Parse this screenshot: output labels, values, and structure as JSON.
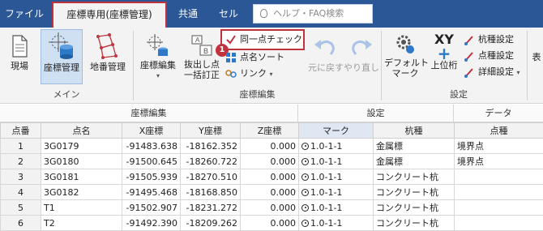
{
  "tabs": [
    {
      "label": "ファイル"
    },
    {
      "label": "座標専用(座標管理)"
    },
    {
      "label": "共通"
    },
    {
      "label": "セル"
    }
  ],
  "search": {
    "placeholder": "ヘルプ・FAQ検索"
  },
  "ribbon": {
    "main": {
      "genba": "現場",
      "zahyo_kanri": "座標管理",
      "chiban_kanri": "地番管理",
      "group_label": "メイン"
    },
    "edit": {
      "zahyo_henshu": "座標編集",
      "nukidashi_line1": "抜出し点",
      "nukidashi_line2": "一括訂正",
      "doitsu_check": "同一点チェック",
      "tenmei_sort": "点名ソート",
      "link": "リンク",
      "undo": "元に戻す",
      "redo": "やり直し",
      "group_label": "座標編集"
    },
    "settings": {
      "default_mark_line1": "デフォルト",
      "default_mark_line2": "マーク",
      "xy_label": "XY",
      "jouiketa": "上位桁",
      "kuiShu": "杭種設定",
      "tenShu": "点種設定",
      "shosai": "詳細設定",
      "hyo": "表",
      "group_label": "設定"
    },
    "badge": "1"
  },
  "group_headers": {
    "zahyo": "座標編集",
    "settei": "設定",
    "data": "データ"
  },
  "table": {
    "headers": [
      "点番",
      "点名",
      "X座標",
      "Y座標",
      "Z座標",
      "マーク",
      "杭種",
      "点種"
    ],
    "rows": [
      {
        "no": "1",
        "name": "3G0179",
        "x": "-91483.638",
        "y": "-18162.352",
        "z": "0.000",
        "mark": "1.0-1-1",
        "kui": "金属標",
        "ten": "境界点"
      },
      {
        "no": "2",
        "name": "3G0180",
        "x": "-91500.645",
        "y": "-18260.722",
        "z": "0.000",
        "mark": "1.0-1-1",
        "kui": "金属標",
        "ten": "境界点"
      },
      {
        "no": "3",
        "name": "3G0181",
        "x": "-91505.939",
        "y": "-18270.510",
        "z": "0.000",
        "mark": "1.0-1-1",
        "kui": "コンクリート杭",
        "ten": ""
      },
      {
        "no": "4",
        "name": "3G0182",
        "x": "-91495.468",
        "y": "-18168.850",
        "z": "0.000",
        "mark": "1.0-1-1",
        "kui": "コンクリート杭",
        "ten": ""
      },
      {
        "no": "5",
        "name": "T1",
        "x": "-91502.907",
        "y": "-18231.272",
        "z": "0.000",
        "mark": "1.0-1-1",
        "kui": "コンクリート杭",
        "ten": ""
      },
      {
        "no": "6",
        "name": "T2",
        "x": "-91492.390",
        "y": "-18209.262",
        "z": "0.000",
        "mark": "1.0-1-1",
        "kui": "コンクリート杭",
        "ten": ""
      }
    ]
  },
  "colors": {
    "titlebar": "#2b5797",
    "highlight": "#c0333d",
    "selected": "#cfe0f3"
  }
}
